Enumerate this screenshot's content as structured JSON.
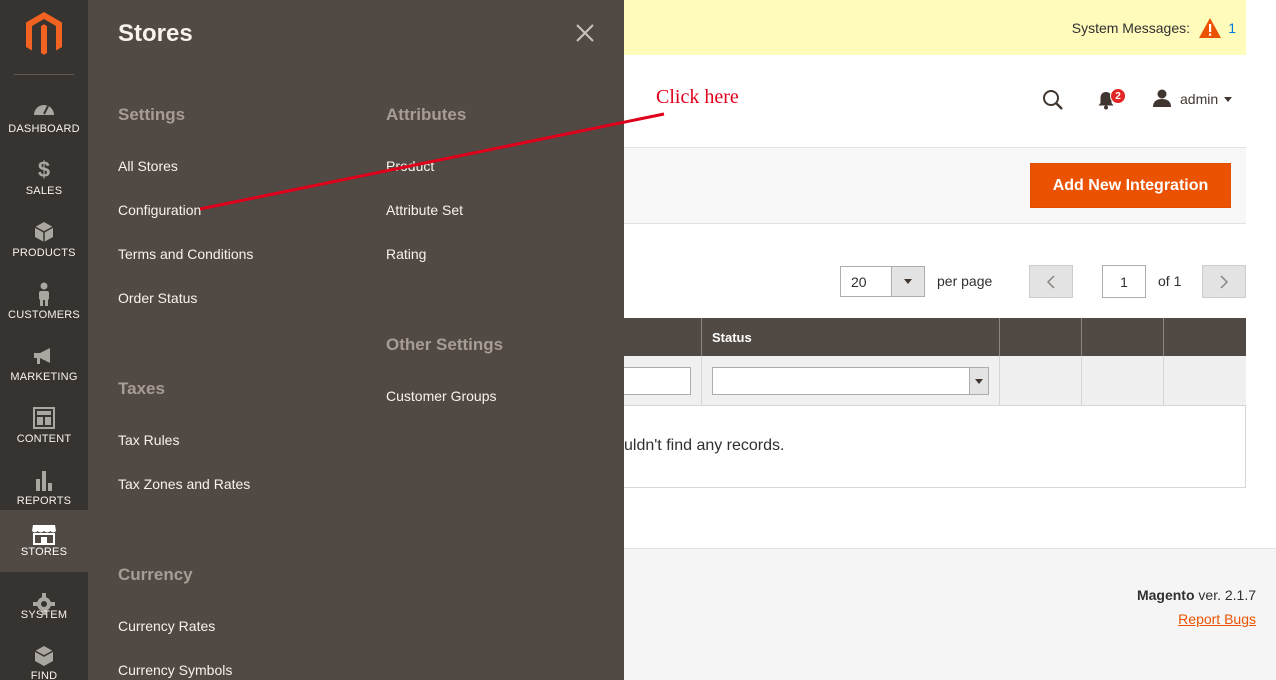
{
  "nav": {
    "items": [
      {
        "label": "Dashboard",
        "icon": "dashboard-icon"
      },
      {
        "label": "Sales",
        "icon": "dollar-icon"
      },
      {
        "label": "Products",
        "icon": "cube-icon"
      },
      {
        "label": "Customers",
        "icon": "person-icon"
      },
      {
        "label": "Marketing",
        "icon": "megaphone-icon"
      },
      {
        "label": "Content",
        "icon": "content-icon"
      },
      {
        "label": "Reports",
        "icon": "bar-chart-icon"
      },
      {
        "label": "Stores",
        "icon": "storefront-icon"
      },
      {
        "label": "System",
        "icon": "gear-icon"
      },
      {
        "label": "Find Partners",
        "icon": "box-icon"
      }
    ]
  },
  "flyout": {
    "title": "Stores",
    "settings": {
      "heading": "Settings",
      "links": [
        "All Stores",
        "Configuration",
        "Terms and Conditions",
        "Order Status"
      ]
    },
    "taxes": {
      "heading": "Taxes",
      "links": [
        "Tax Rules",
        "Tax Zones and Rates"
      ]
    },
    "currency": {
      "heading": "Currency",
      "links": [
        "Currency Rates",
        "Currency Symbols"
      ]
    },
    "attributes": {
      "heading": "Attributes",
      "links": [
        "Product",
        "Attribute Set",
        "Rating"
      ]
    },
    "other": {
      "heading": "Other Settings",
      "links": [
        "Customer Groups"
      ]
    }
  },
  "system_messages": {
    "label": "System Messages:",
    "count": "1"
  },
  "header": {
    "notifications_count": "2",
    "user": "admin"
  },
  "actions": {
    "add_button": "Add New Integration"
  },
  "pager": {
    "per_page_value": "20",
    "per_page_label": "per page",
    "current_page": "1",
    "of_label": "of 1"
  },
  "grid": {
    "status_header": "Status",
    "empty_text": "uldn't find any records."
  },
  "footer": {
    "brand": "Magento",
    "version": " ver. 2.1.7",
    "report_bugs": "Report Bugs"
  },
  "annotation": {
    "text": "Click here"
  },
  "colors": {
    "nav_bg": "#373330",
    "flyout_bg": "#514943",
    "accent": "#eb5202",
    "annotation": "#e0001b",
    "message_bar": "#fffbbb"
  }
}
